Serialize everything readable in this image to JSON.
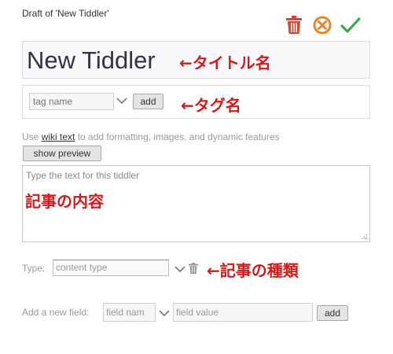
{
  "header": {
    "draft_title": "Draft of 'New Tiddler'"
  },
  "toolbar": {
    "delete_icon": "trash-icon",
    "cancel_icon": "cancel-circle-icon",
    "done_icon": "checkmark-icon",
    "colors": {
      "delete": "#d9432f",
      "cancel": "#e8852b",
      "done": "#3ea850"
    }
  },
  "title_field": {
    "value": "New Tiddler"
  },
  "tags": {
    "placeholder": "tag name",
    "add_label": "add"
  },
  "body": {
    "help_prefix": "Use ",
    "help_link": "wiki text",
    "help_suffix": " to add formatting, images, and dynamic features",
    "preview_label": "show preview",
    "placeholder": "Type the text for this tiddler"
  },
  "type_field": {
    "label": "Type:",
    "placeholder": "content type"
  },
  "new_field": {
    "label": "Add a new field:",
    "name_placeholder": "field nam",
    "value_placeholder": "field value",
    "add_label": "add"
  },
  "annotations": {
    "title": "←タイトル名",
    "tags": "←タグ名",
    "content": "記事の内容",
    "type": "←記事の種類",
    "color": "#d11a1a"
  }
}
